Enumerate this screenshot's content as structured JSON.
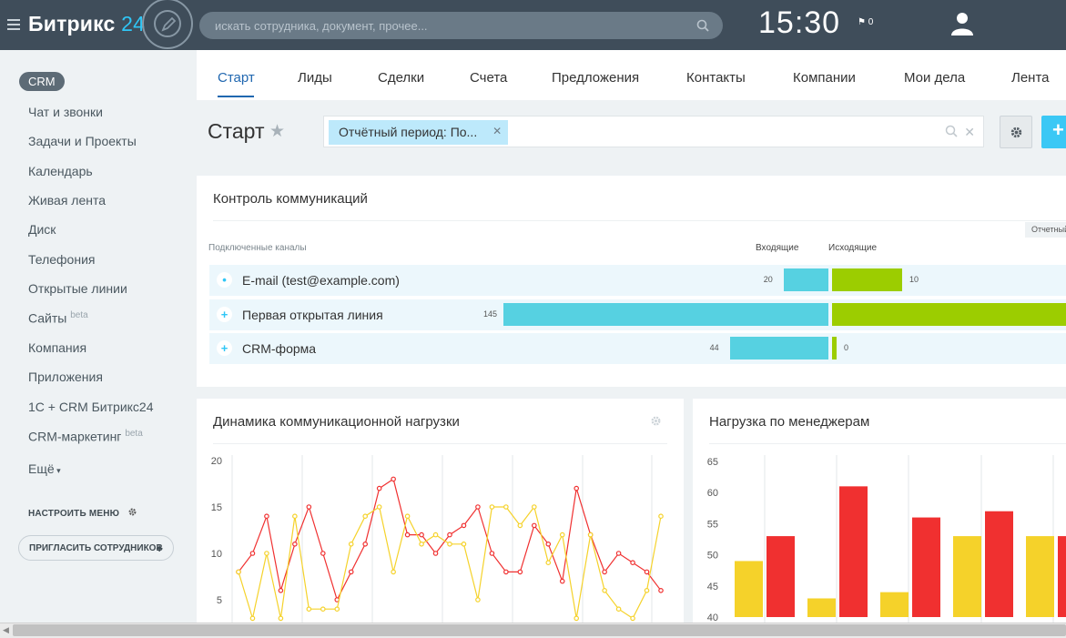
{
  "header": {
    "logo_main": "Битрикс",
    "logo_num": "24",
    "search_placeholder": "искать сотрудника, документ, прочее...",
    "clock": "15:30",
    "flag_count": "0",
    "icons": [
      "menu-icon",
      "pencil-icon",
      "search-icon",
      "flag-icon",
      "user-icon"
    ]
  },
  "sidebar": {
    "badge": "CRM",
    "items": [
      {
        "label": "Чат и звонки"
      },
      {
        "label": "Задачи и Проекты"
      },
      {
        "label": "Календарь"
      },
      {
        "label": "Живая лента"
      },
      {
        "label": "Диск"
      },
      {
        "label": "Телефония"
      },
      {
        "label": "Открытые линии"
      },
      {
        "label": "Сайты",
        "sup": "beta"
      },
      {
        "label": "Компания"
      },
      {
        "label": "Приложения"
      },
      {
        "label": "1С + CRM Битрикс24"
      },
      {
        "label": "CRM-маркетинг",
        "sup": "beta"
      },
      {
        "label": "Ещё"
      }
    ],
    "configure": "НАСТРОИТЬ МЕНЮ",
    "invite": "ПРИГЛАСИТЬ СОТРУДНИКОВ"
  },
  "tabs": [
    "Старт",
    "Лиды",
    "Сделки",
    "Счета",
    "Предложения",
    "Контакты",
    "Компании",
    "Мои дела",
    "Лента"
  ],
  "toolbar": {
    "title": "Старт",
    "filter_chip": "Отчётный период: По...",
    "add": "+"
  },
  "comm_panel": {
    "title": "Контроль коммуникаций",
    "channels_label": "Подключенные каналы",
    "incoming": "Входящие",
    "outgoing": "Исходящие",
    "period_tag": "Отчетный",
    "rows": [
      {
        "name": "E-mail (test@example.com)",
        "incoming": 20,
        "outgoing": 10
      },
      {
        "name": "Первая открытая линия",
        "incoming": 145,
        "outgoing": ""
      },
      {
        "name": "CRM-форма",
        "incoming": 44,
        "outgoing": 0
      }
    ]
  },
  "chart_data": [
    {
      "type": "line",
      "title": "Динамика коммуникационной нагрузки",
      "yticks": [
        "20",
        "15",
        "10",
        "5"
      ],
      "ylim": [
        0,
        20
      ],
      "grid": true,
      "series": [
        {
          "color": "#f03030",
          "values": [
            8,
            10,
            14,
            6,
            11,
            15,
            10,
            5,
            8,
            11,
            17,
            18,
            12,
            12,
            10,
            12,
            13,
            15,
            10,
            8,
            8,
            13,
            11,
            7,
            17,
            12,
            8,
            10,
            9,
            8,
            6
          ]
        },
        {
          "color": "#f5d22a",
          "values": [
            8,
            3,
            10,
            3,
            14,
            4,
            4,
            4,
            11,
            14,
            15,
            8,
            14,
            11,
            12,
            11,
            11,
            5,
            15,
            15,
            13,
            15,
            9,
            12,
            3,
            12,
            6,
            4,
            3,
            6,
            14
          ]
        }
      ]
    },
    {
      "type": "bar",
      "title": "Нагрузка по менеджерам",
      "yticks": [
        "65",
        "60",
        "55",
        "50",
        "45",
        "40"
      ],
      "ylim": [
        40,
        65
      ],
      "grid": true,
      "series": [
        {
          "color": "#f5d22a",
          "values": [
            49,
            43,
            44,
            53,
            53
          ]
        },
        {
          "color": "#f03030",
          "values": [
            53,
            61,
            56,
            57,
            53
          ]
        }
      ]
    }
  ]
}
